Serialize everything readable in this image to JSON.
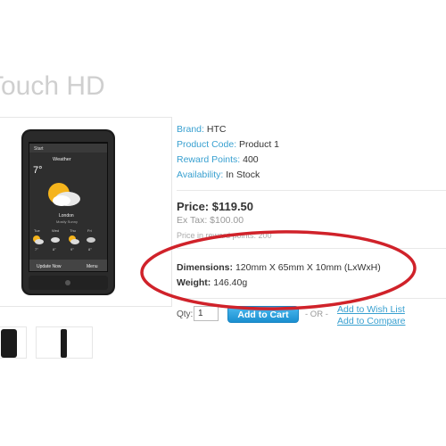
{
  "product": {
    "title": "Touch HD",
    "brand_label": "Brand:",
    "brand_value": "HTC",
    "code_label": "Product Code:",
    "code_value": "Product 1",
    "reward_label": "Reward Points:",
    "reward_value": "400",
    "availability_label": "Availability:",
    "availability_value": "In Stock"
  },
  "pricing": {
    "price": "Price: $119.50",
    "ex_tax": "Ex Tax: $100.00",
    "reward_price": "Price in reward points: 200"
  },
  "specs": {
    "dimensions_label": "Dimensions:",
    "dimensions_value": "120mm X 65mm X 10mm (LxWxH)",
    "weight_label": "Weight:",
    "weight_value": "146.40g"
  },
  "cart": {
    "qty_label": "Qty:",
    "qty_value": "1",
    "add_to_cart": "Add to Cart",
    "or_text": "- OR -",
    "wish_list": "Add to Wish List",
    "compare": "Add to Compare"
  },
  "phone_screen": {
    "weather_title": "Weather",
    "temperature": "7°",
    "city": "London",
    "condition": "Mostly Sunny",
    "days": [
      "Tue",
      "Wed",
      "Thu",
      "Fri"
    ],
    "temps": [
      "7°",
      "8°",
      "9°",
      "8°"
    ],
    "softkey_left": "Update Now",
    "softkey_right": "Menu"
  },
  "colors": {
    "accent": "#38a0d0",
    "annotation": "#d0222a",
    "button": "#1a8fd0"
  }
}
